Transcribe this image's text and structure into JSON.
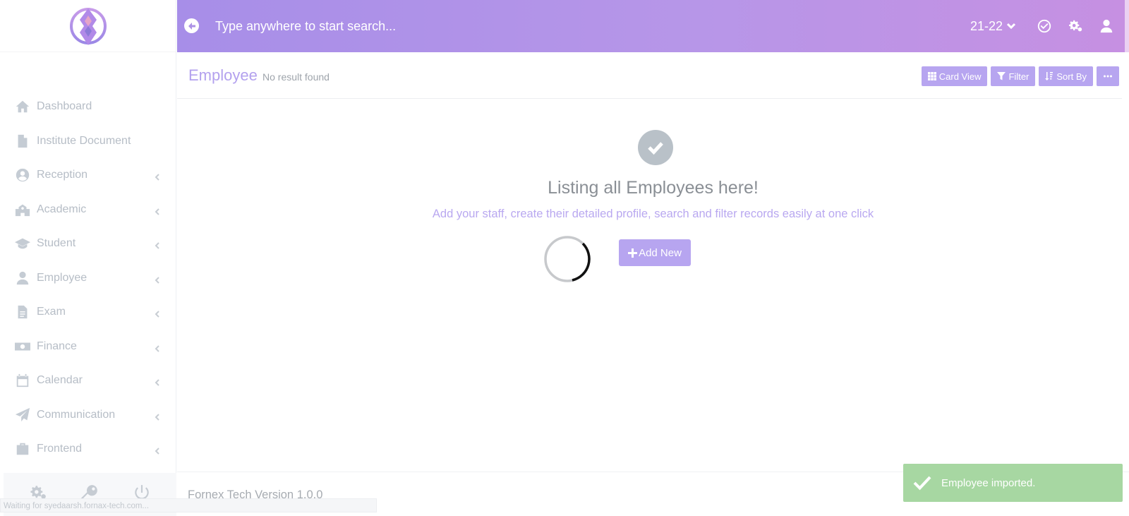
{
  "sidebar": {
    "items": [
      {
        "label": "Dashboard",
        "icon": "home-icon",
        "has_submenu": false
      },
      {
        "label": "Institute Document",
        "icon": "file-icon",
        "has_submenu": false
      },
      {
        "label": "Reception",
        "icon": "user-circle-icon",
        "has_submenu": true
      },
      {
        "label": "Academic",
        "icon": "school-icon",
        "has_submenu": true
      },
      {
        "label": "Student",
        "icon": "graduation-cap-icon",
        "has_submenu": true
      },
      {
        "label": "Employee",
        "icon": "user-tie-icon",
        "has_submenu": true
      },
      {
        "label": "Exam",
        "icon": "file-text-icon",
        "has_submenu": true
      },
      {
        "label": "Finance",
        "icon": "money-bill-icon",
        "has_submenu": true
      },
      {
        "label": "Calendar",
        "icon": "calendar-icon",
        "has_submenu": true
      },
      {
        "label": "Communication",
        "icon": "paper-plane-icon",
        "has_submenu": true
      },
      {
        "label": "Frontend",
        "icon": "suitcase-icon",
        "has_submenu": true
      }
    ],
    "footer_icons": [
      "settings-icon",
      "key-icon",
      "power-icon"
    ]
  },
  "status_url": "Waiting for syedaarsh.fornax-tech.com...",
  "topbar": {
    "search_placeholder": "Type anywhere to start search...",
    "year": "21-22",
    "colors": {
      "gradient_start": "#a78ee8",
      "gradient_end": "#c690e2"
    }
  },
  "header": {
    "title": "Employee",
    "subtitle": "No result found",
    "actions": {
      "card_view": "Card View",
      "filter": "Filter",
      "sort_by": "Sort By"
    }
  },
  "empty_state": {
    "title": "Listing all Employees here!",
    "description": "Add your staff, create their detailed profile, search and filter records easily at one click",
    "add_button": "Add New"
  },
  "footer": {
    "text": "Fornex Tech Version 1.0.0"
  },
  "toast": {
    "message": "Employee imported.",
    "color": "#a7d7a2"
  },
  "accent_color": "#b7a5f0"
}
